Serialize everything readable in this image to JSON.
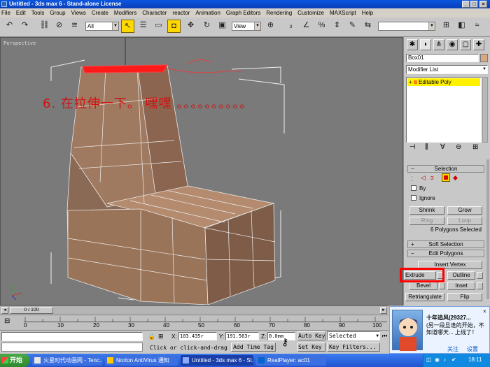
{
  "window": {
    "title": "Untitled - 3ds max 6 - Stand-alone License",
    "controls": [
      "_",
      "□",
      "×"
    ]
  },
  "menu": [
    "File",
    "Edit",
    "Tools",
    "Group",
    "Views",
    "Create",
    "Modifiers",
    "Character",
    "reactor",
    "Animation",
    "Graph Editors",
    "Rendering",
    "Customize",
    "MAXScript",
    "Help"
  ],
  "toolbar": {
    "filter_value": "All",
    "refcoord_value": "View"
  },
  "viewport": {
    "label": "Perspective",
    "annotation": "6. 在拉伸一下。  嘿嘿  。。。。。。。。。。"
  },
  "command_panel": {
    "object_name": "Box01",
    "object_color": "#d8a880",
    "modifier_list_label": "Modifier List",
    "stack_item": "Editable Poly",
    "selection": {
      "header": "Selection",
      "by_label": "By",
      "ignore_label": "Ignore",
      "shrink": "Shrink",
      "grow": "Grow",
      "ring": "Ring",
      "loop": "Loop",
      "status": "6 Polygons Selected"
    },
    "soft_selection_header": "Soft Selection",
    "edit_polygons": {
      "header": "Edit Polygons",
      "insert_vertex": "Insert Vertex",
      "extrude": "Extrude",
      "outline": "Outline",
      "bevel": "Bevel",
      "inset": "Inset",
      "retriangulate": "Retriangulate",
      "flip": "Flip"
    }
  },
  "timeline": {
    "frame_readout": "0 / 100",
    "ticks": [
      "0",
      "10",
      "20",
      "30",
      "40",
      "50",
      "60",
      "70",
      "80",
      "90",
      "100"
    ]
  },
  "status": {
    "x_label": "X:",
    "x_value": "103.435r",
    "y_label": "Y:",
    "y_value": "191.563r",
    "z_label": "Z:",
    "z_value": "0.0mm",
    "prompt": "Click or click-and-drag",
    "add_time_tag": "Add Time Tag",
    "auto_key": "Auto Key",
    "set_key": "Set Key",
    "selected_value": "Selected",
    "key_filters": "Key Filters..."
  },
  "qq_popup": {
    "title": "十年追风(29327...",
    "message": "(另一段旦逢的开始，不知道哪天... 上线了！",
    "btn_close": "关注",
    "btn_settings": "设置"
  },
  "taskbar": {
    "start": "开始",
    "tasks": [
      "火星时代动画网 - Tenc...",
      "Norton AntiVirus 通知",
      "Untitled - 3ds max 6 - St...",
      "RealPlayer: ac01"
    ],
    "clock": "18:11"
  }
}
